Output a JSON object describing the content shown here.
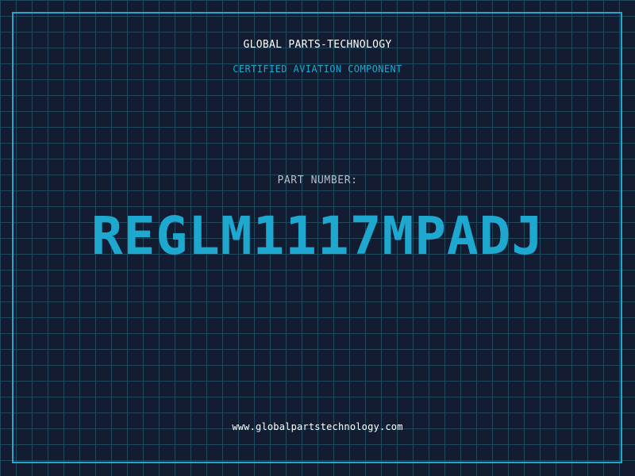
{
  "header": {
    "company": "GLOBAL PARTS-TECHNOLOGY",
    "subtitle": "CERTIFIED AVIATION COMPONENT"
  },
  "part": {
    "label": "PART NUMBER:",
    "number": "REGLM1117MPADJ"
  },
  "footer": {
    "url": "www.globalpartstechnology.com"
  },
  "colors": {
    "background": "#131c30",
    "grid": "#1f4a5e",
    "accent": "#1ea7cf",
    "text": "#ffffff",
    "muted": "#b5bfcc"
  }
}
